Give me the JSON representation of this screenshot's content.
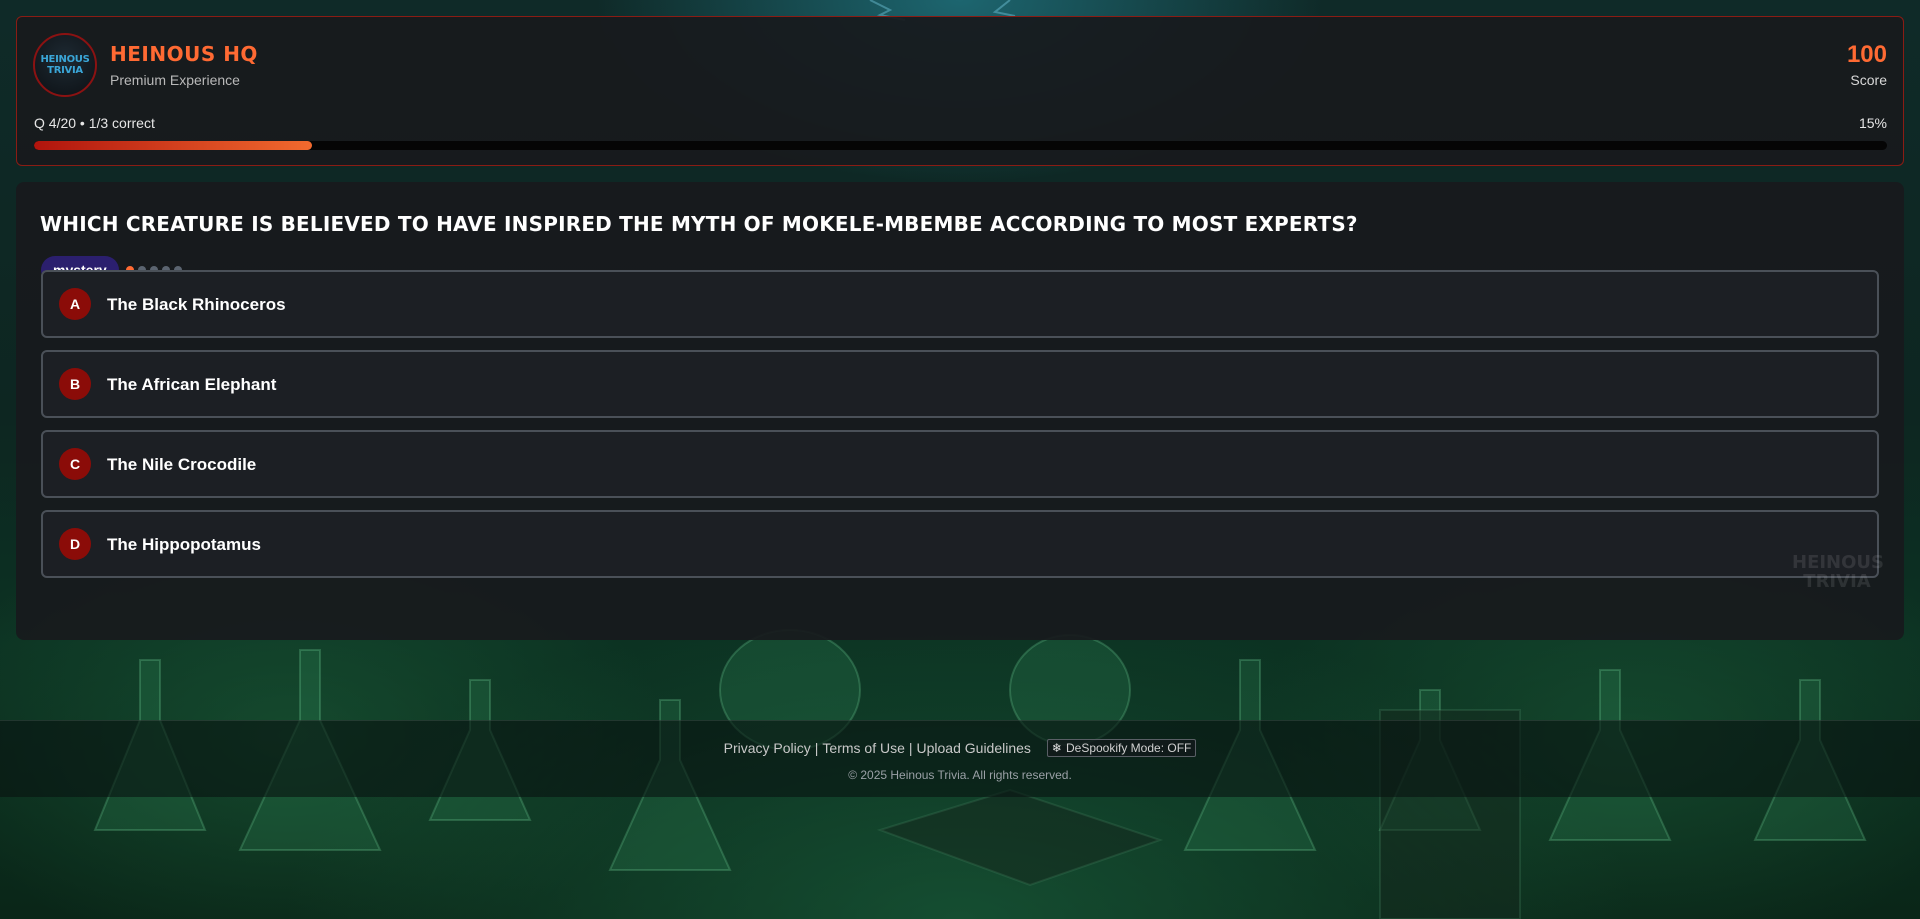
{
  "header": {
    "logo_lines": [
      "HEINOUS",
      "TRIVIA"
    ],
    "title": "HEINOUS HQ",
    "subtitle": "Premium Experience",
    "score_value": "100",
    "score_label": "Score",
    "progress_text": "Q 4/20 • 1/3 correct",
    "progress_percent_label": "15%",
    "progress_fraction": 0.15
  },
  "question": {
    "text": "WHICH CREATURE IS BELIEVED TO HAVE INSPIRED THE MYTH OF MOKELE-MBEMBE ACCORDING TO MOST EXPERTS?",
    "category": "mystery",
    "difficulty_level": 1,
    "difficulty_max": 5,
    "answers": [
      {
        "letter": "A",
        "text": "The Black Rhinoceros"
      },
      {
        "letter": "B",
        "text": "The African Elephant"
      },
      {
        "letter": "C",
        "text": "The Nile Crocodile"
      },
      {
        "letter": "D",
        "text": "The Hippopotamus"
      }
    ],
    "watermark_lines": [
      "HEINOUS",
      "TRIVIA"
    ]
  },
  "footer": {
    "links": [
      "Privacy Policy",
      "Terms of Use",
      "Upload Guidelines"
    ],
    "despookify_label": "DeSpookify Mode: OFF",
    "copyright": "© 2025 Heinous Trivia. All rights reserved."
  },
  "colors": {
    "accent": "#ff6a33",
    "answer_letter_bg": "#8b0c08",
    "category_bg": "#2b1f6e",
    "header_border": "#8a1c14"
  }
}
